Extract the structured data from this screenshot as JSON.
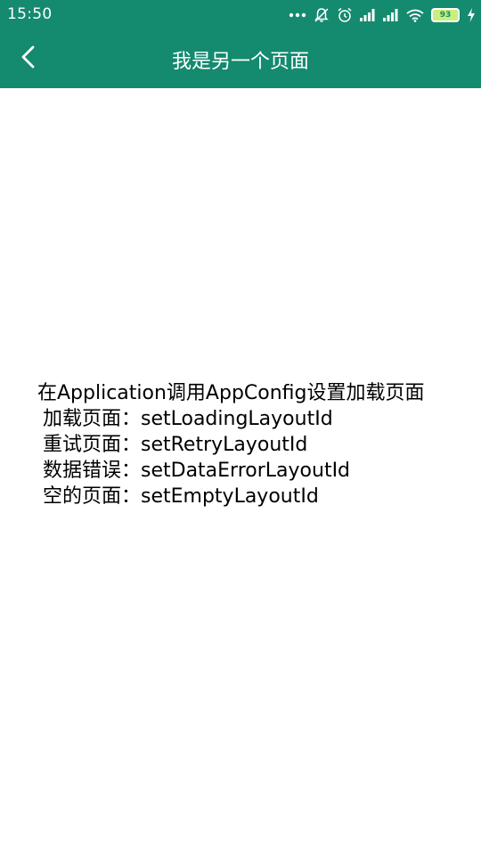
{
  "status_bar": {
    "time": "15:50",
    "battery_level": "93",
    "icons": [
      "more-dots-icon",
      "mute-icon",
      "alarm-icon",
      "signal-icon",
      "signal-icon",
      "wifi-icon",
      "battery-icon",
      "charging-icon"
    ]
  },
  "toolbar": {
    "title": "我是另一个页面",
    "back_icon": "back-arrow-icon"
  },
  "content": {
    "intro": "在Application调用AppConfig设置加载页面",
    "rows": [
      "加载页面：setLoadingLayoutId",
      "重试页面：setRetryLayoutId",
      "数据错误：setDataErrorLayoutId",
      "空的页面：setEmptyLayoutId"
    ]
  },
  "colors": {
    "primary": "#148a6e",
    "text": "#000000",
    "background": "#ffffff"
  }
}
